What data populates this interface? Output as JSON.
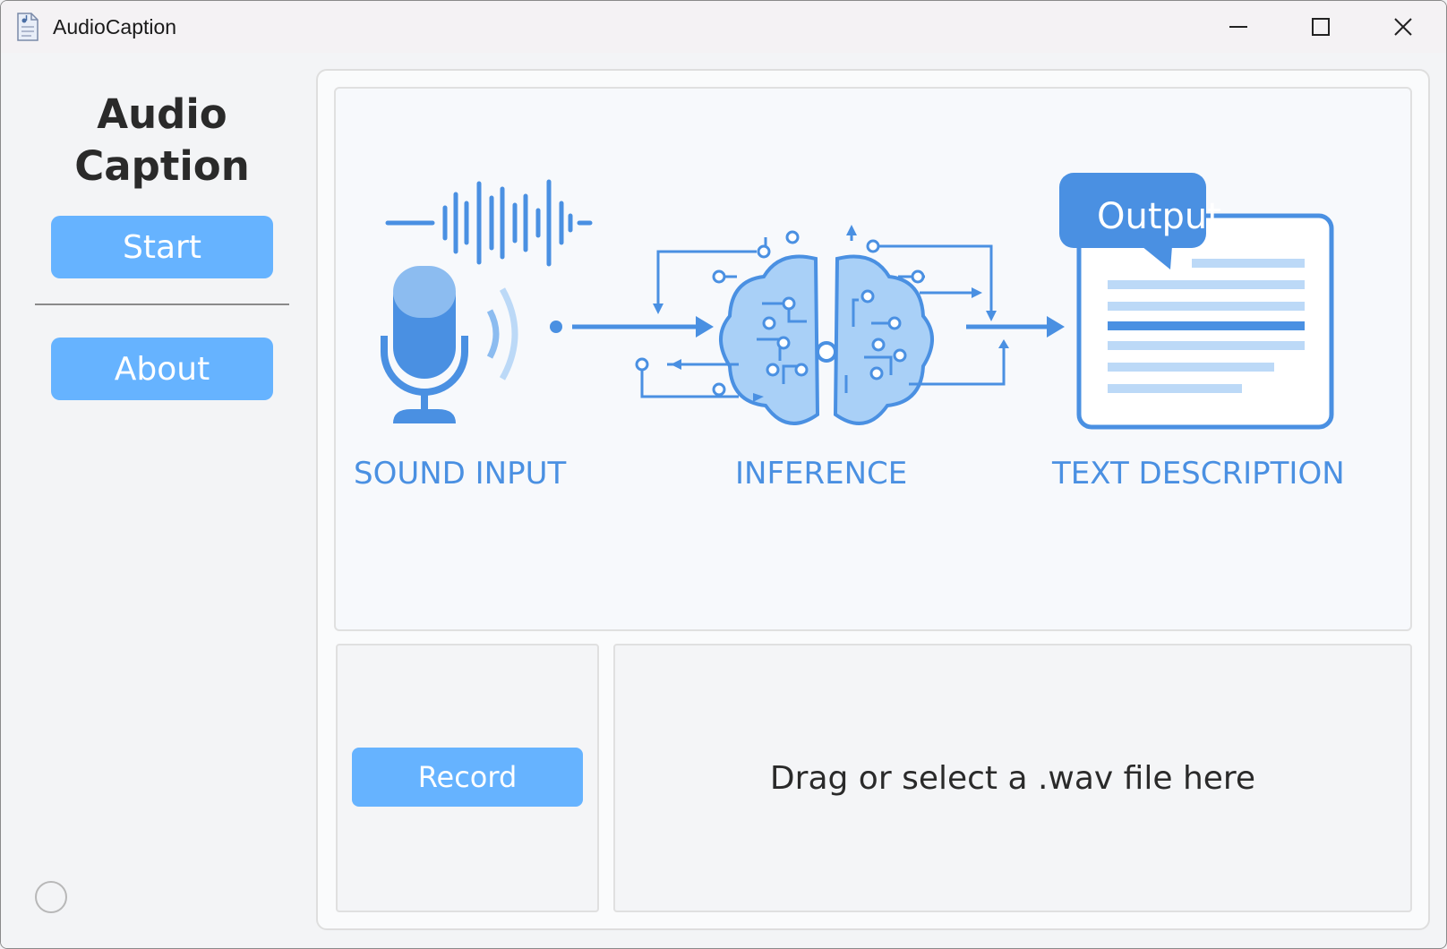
{
  "window": {
    "title": "AudioCaption",
    "icon": "document-music-icon",
    "controls": [
      "minimize-icon",
      "maximize-icon",
      "close-icon"
    ]
  },
  "sidebar": {
    "brand_line1": "Audio",
    "brand_line2": "Caption",
    "start_label": "Start",
    "about_label": "About",
    "status_icon": "status-circle-icon"
  },
  "illustration": {
    "stages": {
      "sound_input": "SOUND INPUT",
      "inference": "INFERENCE",
      "text_description": "TEXT DESCRIPTION"
    },
    "output_badge": "Output",
    "icons": [
      "waveform-icon",
      "microphone-icon",
      "brain-icon",
      "document-icon"
    ]
  },
  "controls": {
    "record_label": "Record",
    "drop_text": "Drag or select a .wav file here"
  },
  "colors": {
    "accent": "#66b3ff",
    "illustration_blue": "#4a90e2",
    "illustration_light": "#a9d0f7"
  }
}
